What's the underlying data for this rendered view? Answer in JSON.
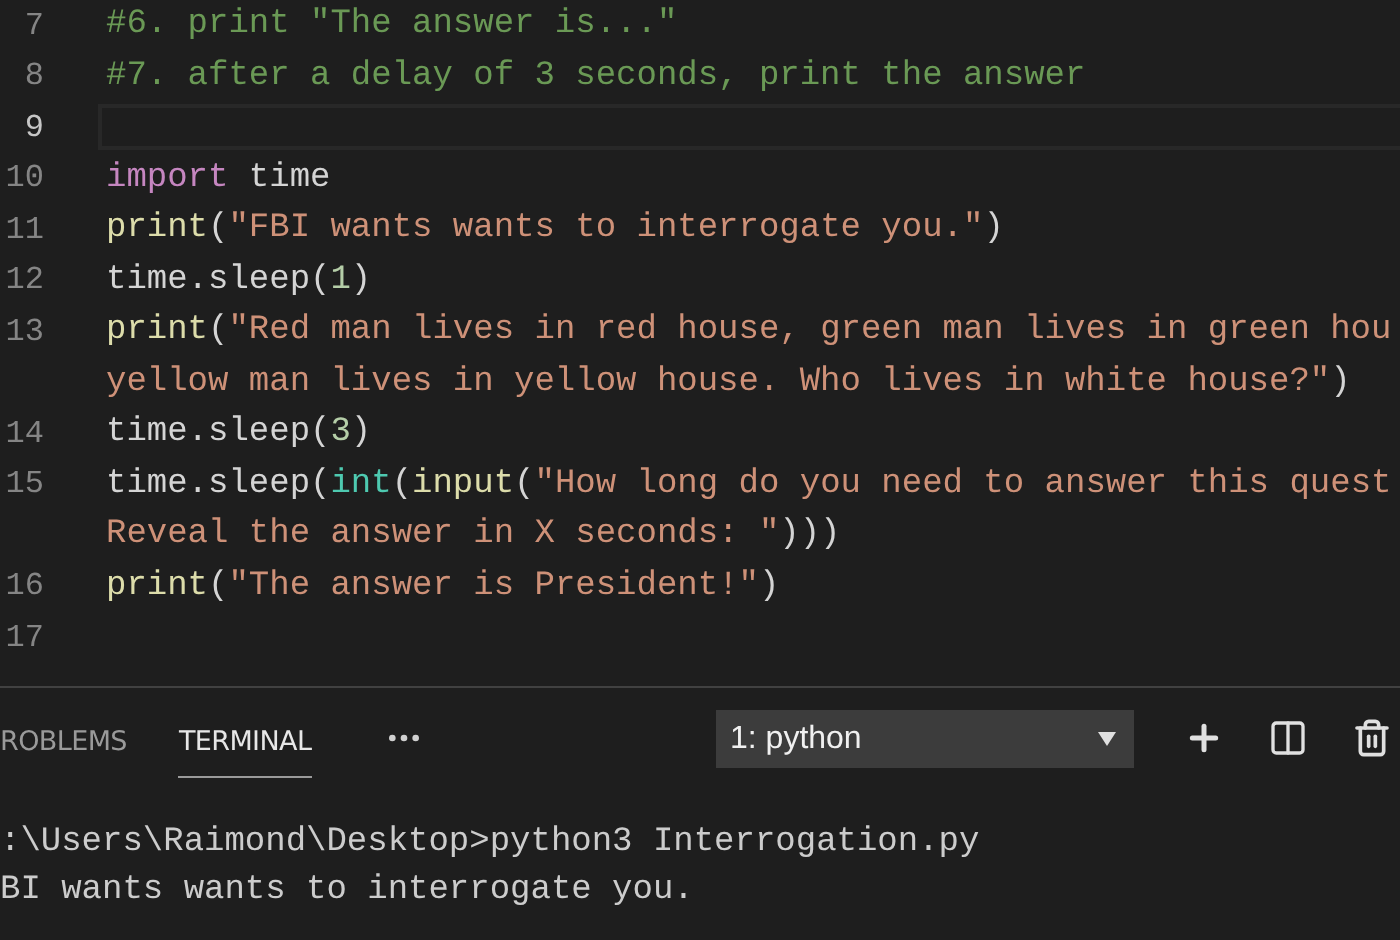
{
  "editor": {
    "lines": [
      {
        "number": "7",
        "current": false,
        "tokens": [
          {
            "kind": "comment",
            "text": "#6. print \"The answer is...\""
          }
        ]
      },
      {
        "number": "8",
        "current": false,
        "tokens": [
          {
            "kind": "comment",
            "text": "#7. after a delay of 3 seconds, print the answer"
          }
        ]
      },
      {
        "number": "9",
        "current": true
      },
      {
        "number": "10",
        "current": false,
        "tokens": [
          {
            "kind": "keyword",
            "text": "import"
          },
          {
            "kind": "plain",
            "text": " time"
          }
        ]
      },
      {
        "number": "11",
        "current": false,
        "tokens": [
          {
            "kind": "function",
            "text": "print"
          },
          {
            "kind": "plain",
            "text": "("
          },
          {
            "kind": "string",
            "text": "\"FBI wants wants to interrogate you.\""
          },
          {
            "kind": "plain",
            "text": ")"
          }
        ]
      },
      {
        "number": "12",
        "current": false,
        "tokens": [
          {
            "kind": "plain",
            "text": "time.sleep("
          },
          {
            "kind": "number",
            "text": "1"
          },
          {
            "kind": "plain",
            "text": ")"
          }
        ]
      },
      {
        "number": "13",
        "current": false,
        "tokens": [
          {
            "kind": "function",
            "text": "print"
          },
          {
            "kind": "plain",
            "text": "("
          },
          {
            "kind": "string",
            "text": "\"Red man lives in red house, green man lives in green hou"
          }
        ]
      },
      {
        "current": false,
        "tokens": [
          {
            "kind": "string",
            "text": "yellow man lives in yellow house. Who lives in white house?\""
          },
          {
            "kind": "plain",
            "text": ")"
          }
        ]
      },
      {
        "number": "14",
        "current": false,
        "tokens": [
          {
            "kind": "plain",
            "text": "time.sleep("
          },
          {
            "kind": "number",
            "text": "3"
          },
          {
            "kind": "plain",
            "text": ")"
          }
        ]
      },
      {
        "number": "15",
        "current": false,
        "tokens": [
          {
            "kind": "plain",
            "text": "time.sleep("
          },
          {
            "kind": "type",
            "text": "int"
          },
          {
            "kind": "plain",
            "text": "("
          },
          {
            "kind": "function",
            "text": "input"
          },
          {
            "kind": "plain",
            "text": "("
          },
          {
            "kind": "string",
            "text": "\"How long do you need to answer this quest"
          }
        ]
      },
      {
        "current": false,
        "tokens": [
          {
            "kind": "string",
            "text": "Reveal the answer in X seconds: \""
          },
          {
            "kind": "plain",
            "text": ")))"
          }
        ]
      },
      {
        "number": "16",
        "current": false,
        "tokens": [
          {
            "kind": "function",
            "text": "print"
          },
          {
            "kind": "plain",
            "text": "("
          },
          {
            "kind": "string",
            "text": "\"The answer is President!\""
          },
          {
            "kind": "plain",
            "text": ")"
          }
        ]
      },
      {
        "number": "17",
        "current": false
      }
    ]
  },
  "panel": {
    "tabs": [
      {
        "label": "ROBLEMS",
        "selected": false
      },
      {
        "label": "TERMINAL",
        "selected": true
      }
    ],
    "terminal_select": {
      "value": "1: python"
    },
    "terminal_lines": [
      ":\\Users\\Raimond\\Desktop>python3 Interrogation.py",
      "BI wants wants to interrogate you."
    ]
  }
}
